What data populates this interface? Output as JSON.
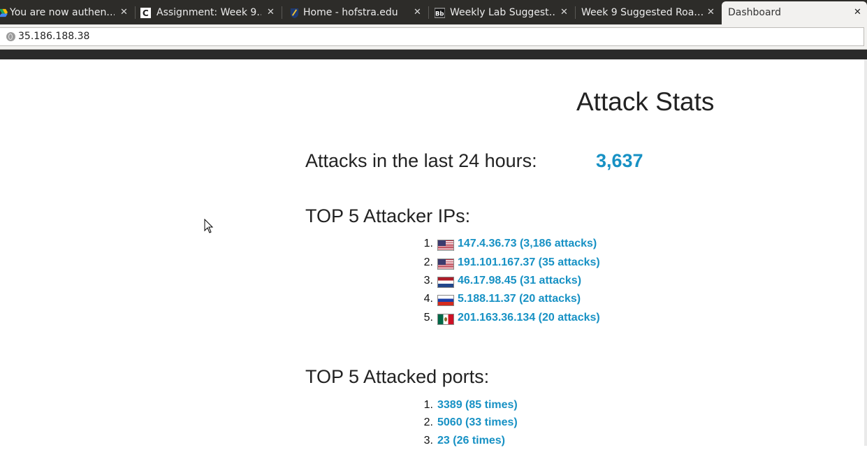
{
  "browser": {
    "tabs": [
      {
        "label": "You are now authen…",
        "icon": "google-drive-icon",
        "active": false
      },
      {
        "label": "Assignment: Week 9…",
        "icon": "canvas-c-icon",
        "active": false
      },
      {
        "label": "Home - hofstra.edu",
        "icon": "hofstra-shield-icon",
        "active": false
      },
      {
        "label": "Weekly Lab Suggest…",
        "icon": "blackboard-bb-icon",
        "active": false
      },
      {
        "label": "Week 9 Suggested Roa…",
        "icon": "",
        "active": false
      },
      {
        "label": "Dashboard",
        "icon": "",
        "active": true
      }
    ],
    "close_glyph": "✕",
    "url": "35.186.188.38"
  },
  "page": {
    "title": "Attack Stats",
    "attacks_heading": "Attacks in the last 24 hours:",
    "attacks_count": "3,637",
    "top_ips_heading": "TOP 5 Attacker IPs:",
    "top_ips": [
      {
        "num": "1.",
        "flag": "us-flag-icon",
        "text": "147.4.36.73 (3,186 attacks)"
      },
      {
        "num": "2.",
        "flag": "us-flag-icon",
        "text": "191.101.167.37 (35 attacks)"
      },
      {
        "num": "3.",
        "flag": "netherlands-flag-icon",
        "text": "46.17.98.45 (31 attacks)"
      },
      {
        "num": "4.",
        "flag": "russia-flag-icon",
        "text": "5.188.11.37 (20 attacks)"
      },
      {
        "num": "5.",
        "flag": "mexico-flag-icon",
        "text": "201.163.36.134 (20 attacks)"
      }
    ],
    "top_ports_heading": "TOP 5 Attacked ports:",
    "top_ports": [
      {
        "num": "1.",
        "text": "3389 (85 times)"
      },
      {
        "num": "2.",
        "text": "5060 (33 times)"
      },
      {
        "num": "3.",
        "text": "23 (26 times)"
      }
    ]
  },
  "colors": {
    "link": "#1791c4",
    "tabstrip": "#2d2c29",
    "active_tab": "#f2f1ef"
  }
}
